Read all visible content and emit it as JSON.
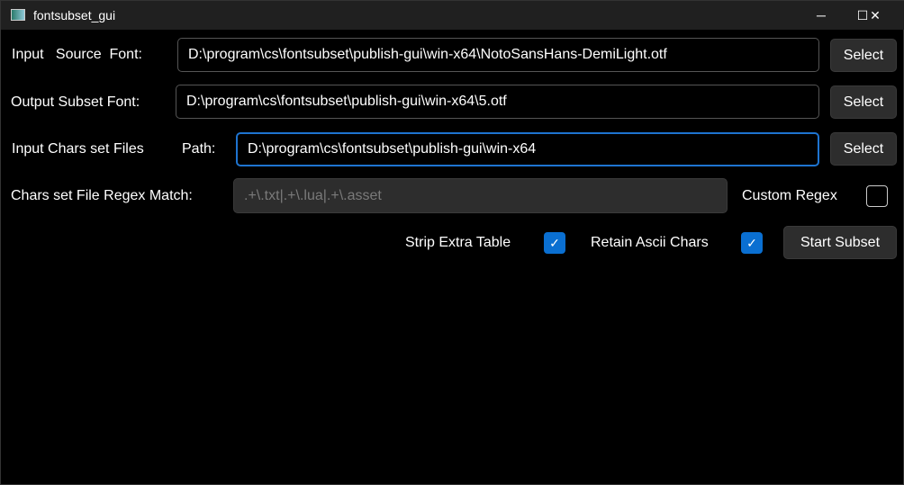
{
  "window": {
    "title": "fontsubset_gui",
    "minimize": "─",
    "maximize": "☐",
    "close": "✕"
  },
  "rows": {
    "source": {
      "label": "Input   Source  Font:",
      "value": "D:\\program\\cs\\fontsubset\\publish-gui\\win-x64\\NotoSansHans-DemiLight.otf",
      "button": "Select"
    },
    "output": {
      "label": "Output Subset Font:",
      "value": "D:\\program\\cs\\fontsubset\\publish-gui\\win-x64\\5.otf",
      "button": "Select"
    },
    "chars": {
      "label": "Input Chars set Files",
      "label2": "Path:",
      "value": "D:\\program\\cs\\fontsubset\\publish-gui\\win-x64",
      "button": "Select"
    },
    "regex": {
      "label": "Chars set File Regex Match:",
      "value": ".+\\.txt|.+\\.lua|.+\\.asset",
      "custom_label": "Custom Regex",
      "custom_checked": false
    }
  },
  "options": {
    "strip_label": "Strip Extra Table",
    "strip_checked": true,
    "retain_label": "Retain Ascii Chars",
    "retain_checked": true,
    "start_button": "Start Subset",
    "check_glyph": "✓"
  },
  "colors": {
    "accent": "#0a6fd1"
  }
}
